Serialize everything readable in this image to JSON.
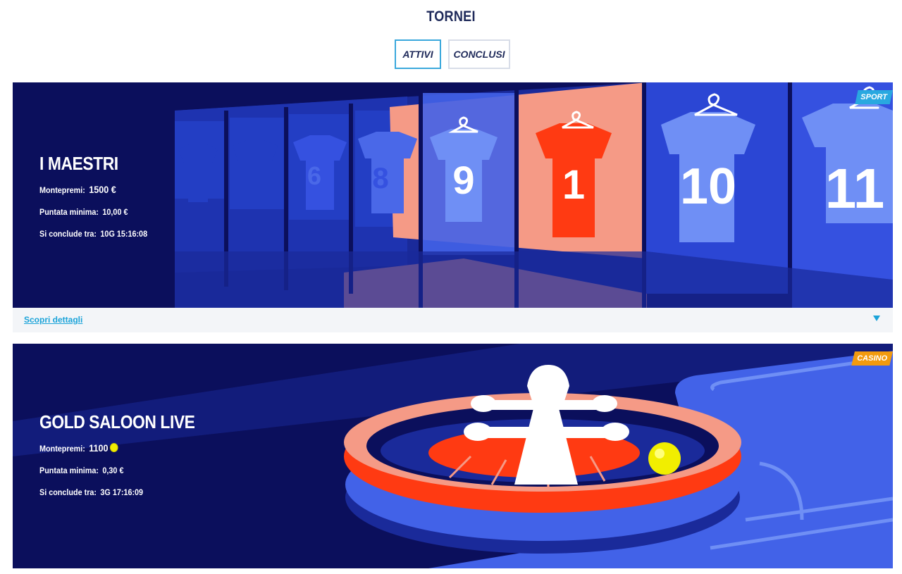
{
  "page": {
    "title": "TORNEI"
  },
  "tabs": [
    {
      "label": "ATTIVI",
      "active": true
    },
    {
      "label": "CONCLUSI",
      "active": false
    }
  ],
  "tournaments": [
    {
      "name": "I MAESTRI",
      "category": "SPORT",
      "category_color": "#29a8e0",
      "prize_label": "Montepremi:",
      "prize_value": "1500 €",
      "min_bet_label": "Puntata minima:",
      "min_bet_value": "10,00 €",
      "ends_label": "Si conclude tra:",
      "ends_value": "10G 15:16:08",
      "details_label": "Scopri dettagli",
      "jersey_numbers": [
        "6",
        "8",
        "9",
        "1",
        "10",
        "11"
      ]
    },
    {
      "name": "GOLD SALOON LIVE",
      "category": "CASINO",
      "category_color": "#f29a0e",
      "prize_label": "Montepremi:",
      "prize_value": "1100",
      "prize_icon": "coin-icon",
      "min_bet_label": "Puntata minima:",
      "min_bet_value": "0,30 €",
      "ends_label": "Si conclude tra:",
      "ends_value": "3G 17:16:09"
    }
  ],
  "colors": {
    "navy": "#0b0f5c",
    "blue": "#4262e8",
    "light_blue": "#6f8ff5",
    "salmon": "#f59a86",
    "red": "#ff3a12",
    "yellow": "#f1ee00",
    "accent": "#1aa3d9"
  }
}
